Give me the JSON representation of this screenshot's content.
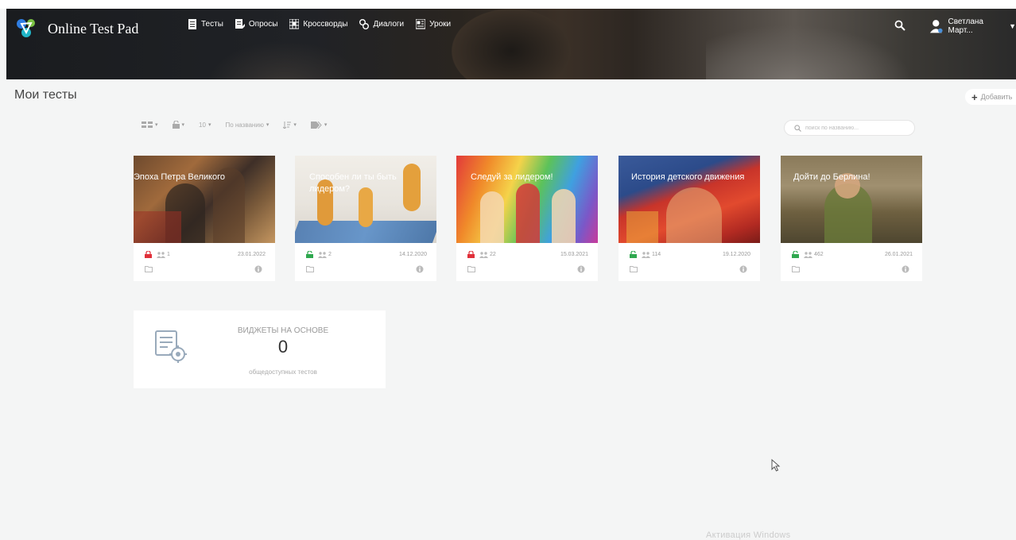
{
  "app": {
    "name": "Online Test Pad"
  },
  "nav": [
    {
      "label": "Тесты",
      "icon": "test-icon"
    },
    {
      "label": "Опросы",
      "icon": "poll-icon"
    },
    {
      "label": "Кроссворды",
      "icon": "crossword-icon"
    },
    {
      "label": "Диалоги",
      "icon": "dialog-icon"
    },
    {
      "label": "Уроки",
      "icon": "lesson-icon"
    }
  ],
  "user": {
    "name": "Светлана Март..."
  },
  "page": {
    "title": "Мои тесты",
    "add_label": "Добавить"
  },
  "toolbar": {
    "page_size": "10",
    "sort_label": "По названию",
    "search_placeholder": "поиск по названию..."
  },
  "tests": [
    {
      "title": "Эпоха Петра Великого",
      "access": "locked",
      "lock_color": "#e0303a",
      "users": "1",
      "date": "23.01.2022"
    },
    {
      "title": "Способен ли ты быть лидером?",
      "access": "open",
      "lock_color": "#2fa84f",
      "users": "2",
      "date": "14.12.2020"
    },
    {
      "title": "Следуй за лидером!",
      "access": "locked",
      "lock_color": "#e0303a",
      "users": "22",
      "date": "15.03.2021"
    },
    {
      "title": "История детского движения",
      "access": "open",
      "lock_color": "#2fa84f",
      "users": "114",
      "date": "19.12.2020"
    },
    {
      "title": "Дойти до Берлина!",
      "access": "open",
      "lock_color": "#2fa84f",
      "users": "462",
      "date": "26.01.2021"
    }
  ],
  "widget": {
    "title": "ВИДЖЕТЫ НА ОСНОВЕ",
    "count": "0",
    "subtitle": "общедоступных тестов"
  },
  "watermark": "Активация Windows"
}
